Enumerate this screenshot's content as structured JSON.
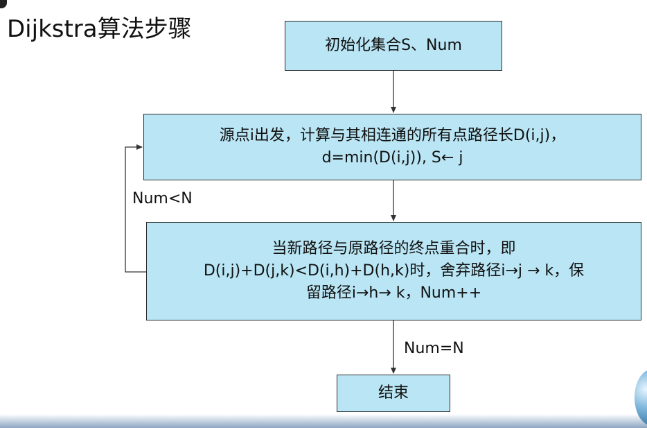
{
  "title": "Dijkstra算法步骤",
  "flowchart": {
    "init_box": {
      "line1": "初始化集合S、Num"
    },
    "source_box": {
      "line1": "源点i出发，计算与其相连通的所有点路径长D(i,j)，",
      "line2": "d=min(D(i,j)), S← j"
    },
    "compare_box": {
      "line1": "当新路径与原路径的终点重合时，即",
      "line2": "D(i,j)+D(j,k)<D(i,h)+D(h,k)时，舍弃路径i→j → k，保",
      "line3": "留路径i→h→ k，Num++"
    },
    "end_box": {
      "line1": "结束"
    },
    "loop_label": "Num<N",
    "exit_label": "Num=N"
  },
  "colors": {
    "box_fill": "#b9e5f4",
    "box_border": "#2a2a2a",
    "connector": "#333333"
  }
}
